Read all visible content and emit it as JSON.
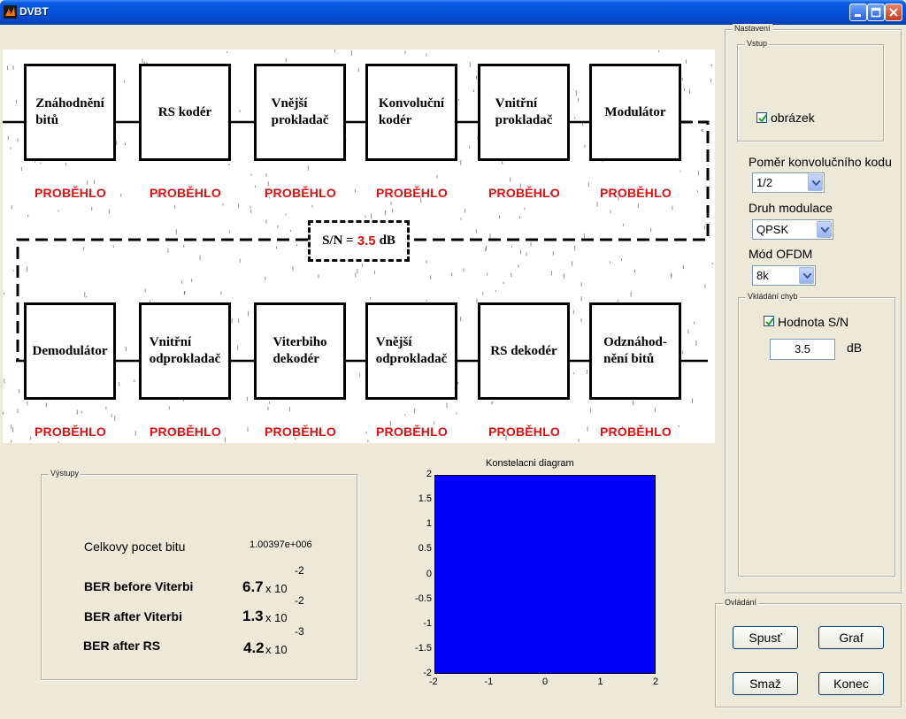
{
  "window": {
    "title": "DVBT",
    "controls": [
      "minimize-icon",
      "maximize-icon",
      "close-icon"
    ]
  },
  "diagram": {
    "top_row": [
      {
        "label": "Znáhodnění\nbitů",
        "status": "PROBĚHLO"
      },
      {
        "label": "RS kodér",
        "status": "PROBĚHLO"
      },
      {
        "label": "Vnější\nprokladač",
        "status": "PROBĚHLO"
      },
      {
        "label": "Konvoluční\nkodér",
        "status": "PROBĚHLO"
      },
      {
        "label": "Vnitřní\nprokladač",
        "status": "PROBĚHLO"
      },
      {
        "label": "Modulátor",
        "status": "PROBĚHLO"
      }
    ],
    "bottom_row": [
      {
        "label": "Demodulátor",
        "status": "PROBĚHLO"
      },
      {
        "label": "Vnitřní\nodprokladač",
        "status": "PROBĚHLO"
      },
      {
        "label": "Viterbiho\ndekodér",
        "status": "PROBĚHLO"
      },
      {
        "label": "Vnější\nodprokladač",
        "status": "PROBĚHLO"
      },
      {
        "label": "RS dekodér",
        "status": "PROBĚHLO"
      },
      {
        "label": "Odznáhod-\nnění bitů",
        "status": "PROBĚHLO"
      }
    ],
    "sn": {
      "prefix": "S/N =",
      "value": "3.5",
      "unit": "dB"
    }
  },
  "settings": {
    "title": "Nastavení",
    "input_group": {
      "title": "Vstup",
      "checkbox_label": "obrázek",
      "checked": true
    },
    "code_rate": {
      "label": "Poměr konvolučního kodu",
      "value": "1/2"
    },
    "modulation": {
      "label": "Druh modulace",
      "value": "QPSK"
    },
    "ofdm_mode": {
      "label": "Mód OFDM",
      "value": "8k"
    },
    "error_group": {
      "title": "Vkládání chyb",
      "checkbox_label": "Hodnota S/N",
      "checked": true,
      "sn_value": "3.5",
      "unit": "dB"
    }
  },
  "controls": {
    "title": "Ovládání",
    "run": "Spusť",
    "graph": "Graf",
    "clear": "Smaž",
    "end": "Konec"
  },
  "outputs": {
    "title": "Výstupy",
    "total_bits_label": "Celkovy pocet bitu",
    "total_bits_value": "1.00397e+006",
    "ber_before_label": "BER before Viterbi",
    "ber_before_mantissa": "6.7",
    "ber_before_exp": "-2",
    "ber_after_label": "BER after Viterbi",
    "ber_after_mantissa": "1.3",
    "ber_after_exp": "-2",
    "ber_rs_label": "BER after RS",
    "ber_rs_mantissa": "4.2",
    "ber_rs_exp": "-3",
    "times_ten": "x 10"
  },
  "plot": {
    "title": "Konstelacni diagram",
    "y_ticks": [
      "2",
      "1.5",
      "1",
      "0.5",
      "0",
      "-0.5",
      "-1",
      "-1.5",
      "-2"
    ],
    "x_ticks": [
      "-2",
      "-1",
      "0",
      "1",
      "2"
    ],
    "fill_color": "#0000ff"
  }
}
